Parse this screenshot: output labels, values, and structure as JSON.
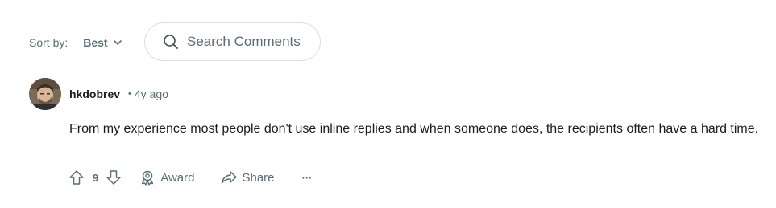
{
  "sort": {
    "label": "Sort by:",
    "value": "Best"
  },
  "search": {
    "placeholder": "Search Comments"
  },
  "comment": {
    "author": "hkdobrev",
    "separator": "•",
    "time": "4y ago",
    "body": "From my experience most people don't use inline replies and when someone does, the recipients often have a hard time.",
    "score": "9",
    "award_label": "Award",
    "share_label": "Share",
    "more_label": "···"
  },
  "icons": [
    "chevron-down-icon",
    "search-icon",
    "upvote-icon",
    "downvote-icon",
    "award-icon",
    "share-icon"
  ],
  "colors": {
    "muted": "#576f76",
    "text": "#1c1c1c",
    "border": "#dcdfe1"
  }
}
